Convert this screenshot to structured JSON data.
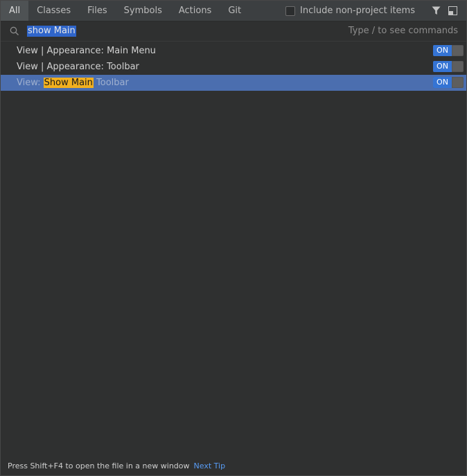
{
  "tabs": [
    {
      "label": "All",
      "active": true
    },
    {
      "label": "Classes",
      "active": false
    },
    {
      "label": "Files",
      "active": false
    },
    {
      "label": "Symbols",
      "active": false
    },
    {
      "label": "Actions",
      "active": false
    },
    {
      "label": "Git",
      "active": false
    }
  ],
  "options": {
    "include_label": "Include non-project items",
    "include_checked": false,
    "filter_icon": "filter-icon",
    "preview_icon": "preview-panel-icon"
  },
  "search": {
    "value": "show Main",
    "hint": "Type / to see commands",
    "icon": "search-icon"
  },
  "results": [
    {
      "prefix": "View | Appearance: Main Menu",
      "toggle": "ON"
    },
    {
      "prefix": "View | Appearance: Toolbar",
      "toggle": "ON"
    },
    {
      "prefix": "View: ",
      "highlight": "Show Main",
      "suffix": " Toolbar",
      "toggle": "ON",
      "selected": true
    }
  ],
  "footer": {
    "tip": "Press Shift+F4 to open the file in a new window",
    "next_tip": "Next Tip"
  },
  "colors": {
    "selection": "#4b6eaf",
    "highlight": "#f2b01e",
    "toggle_on": "#3574d4",
    "link": "#589df6"
  }
}
